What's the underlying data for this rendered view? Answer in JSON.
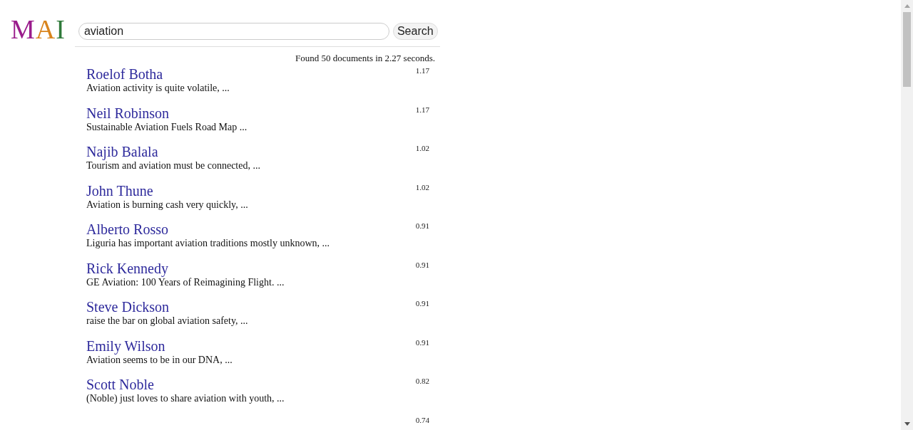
{
  "logo": [
    {
      "letter": "M",
      "color": "#9a1c8c"
    },
    {
      "letter": "A",
      "color": "#d9841c"
    },
    {
      "letter": "I",
      "color": "#2f7a3a"
    }
  ],
  "search": {
    "value": "aviation",
    "button": "Search"
  },
  "summary": "Found 50 documents in 2.27 seconds.",
  "results": [
    {
      "title": "Roelof Botha",
      "snippet": "Aviation activity is quite volatile, ...",
      "score": "1.17"
    },
    {
      "title": "Neil Robinson",
      "snippet": "Sustainable Aviation Fuels Road Map ...",
      "score": "1.17"
    },
    {
      "title": "Najib Balala",
      "snippet": "Tourism and aviation must be connected, ...",
      "score": "1.02"
    },
    {
      "title": "John Thune",
      "snippet": "Aviation is burning cash very quickly, ...",
      "score": "1.02"
    },
    {
      "title": "Alberto Rosso",
      "snippet": "Liguria has important aviation traditions mostly unknown, ...",
      "score": "0.91"
    },
    {
      "title": "Rick Kennedy",
      "snippet": "GE Aviation: 100 Years of Reimagining Flight. ...",
      "score": "0.91"
    },
    {
      "title": "Steve Dickson",
      "snippet": "raise the bar on global aviation safety, ...",
      "score": "0.91"
    },
    {
      "title": "Emily Wilson",
      "snippet": "Aviation seems to be in our DNA, ...",
      "score": "0.91"
    },
    {
      "title": "Scott Noble",
      "snippet": "(Noble) just loves to share aviation with youth, ...",
      "score": "0.82"
    },
    {
      "score": "0.74"
    }
  ]
}
